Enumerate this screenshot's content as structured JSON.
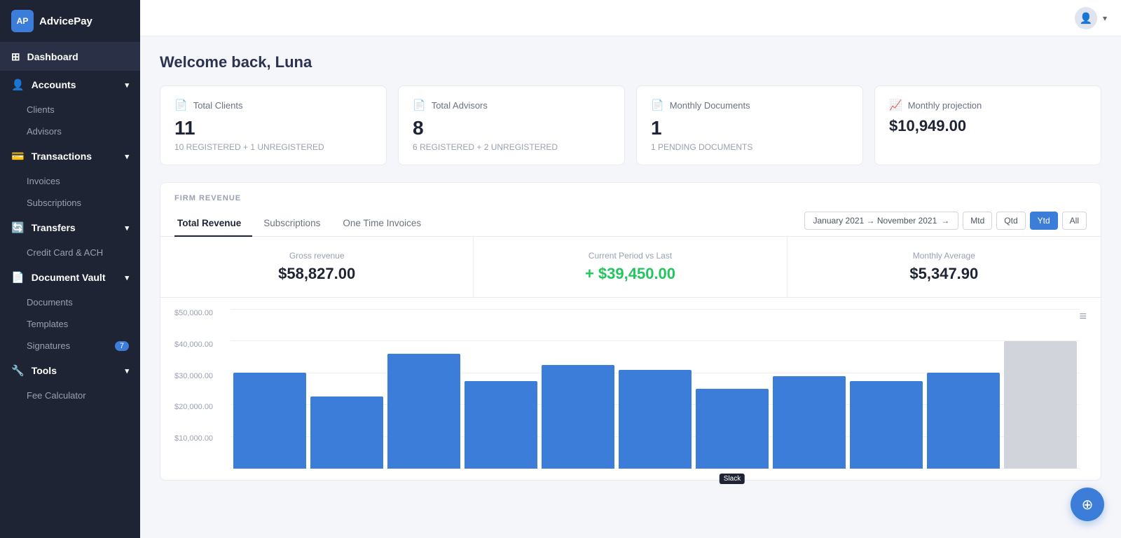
{
  "logo": {
    "abbr": "AP",
    "name": "AdvicePay"
  },
  "topbar": {
    "chevron": "▾"
  },
  "sidebar": {
    "items": [
      {
        "id": "dashboard",
        "label": "Dashboard",
        "icon": "⊞",
        "level": "top",
        "expandable": false
      },
      {
        "id": "accounts",
        "label": "Accounts",
        "icon": "👤",
        "level": "top",
        "expandable": true
      },
      {
        "id": "clients",
        "label": "Clients",
        "level": "sub"
      },
      {
        "id": "advisors",
        "label": "Advisors",
        "level": "sub"
      },
      {
        "id": "transactions",
        "label": "Transactions",
        "icon": "💳",
        "level": "top",
        "expandable": true
      },
      {
        "id": "invoices",
        "label": "Invoices",
        "level": "sub"
      },
      {
        "id": "subscriptions",
        "label": "Subscriptions",
        "level": "sub"
      },
      {
        "id": "transfers",
        "label": "Transfers",
        "icon": "🔄",
        "level": "top",
        "expandable": true
      },
      {
        "id": "credit-card-ach",
        "label": "Credit Card & ACH",
        "level": "sub"
      },
      {
        "id": "document-vault",
        "label": "Document Vault",
        "icon": "📄",
        "level": "top",
        "expandable": true
      },
      {
        "id": "documents",
        "label": "Documents",
        "level": "sub"
      },
      {
        "id": "templates",
        "label": "Templates",
        "level": "sub"
      },
      {
        "id": "signatures",
        "label": "Signatures",
        "level": "sub",
        "badge": "7"
      },
      {
        "id": "tools",
        "label": "Tools",
        "icon": "🔧",
        "level": "top",
        "expandable": true
      },
      {
        "id": "fee-calculator",
        "label": "Fee Calculator",
        "level": "sub"
      }
    ]
  },
  "page": {
    "title": "Welcome back, Luna"
  },
  "stat_cards": [
    {
      "id": "total-clients",
      "icon": "📄",
      "label": "Total Clients",
      "value": "11",
      "sub": "10 REGISTERED + 1 UNREGISTERED"
    },
    {
      "id": "total-advisors",
      "icon": "📄",
      "label": "Total Advisors",
      "value": "8",
      "sub": "6 REGISTERED + 2 UNREGISTERED"
    },
    {
      "id": "monthly-documents",
      "icon": "📄",
      "label": "Monthly Documents",
      "value": "1",
      "sub": "1 PENDING DOCUMENTS"
    },
    {
      "id": "monthly-projection",
      "icon": "📈",
      "label": "Monthly projection",
      "value": "$10,949.00",
      "sub": ""
    }
  ],
  "firm_revenue": {
    "section_label": "FIRM REVENUE",
    "tabs": [
      {
        "id": "total-revenue",
        "label": "Total Revenue",
        "active": true
      },
      {
        "id": "subscriptions",
        "label": "Subscriptions",
        "active": false
      },
      {
        "id": "one-time-invoices",
        "label": "One Time Invoices",
        "active": false
      }
    ],
    "date_range": "January 2021 → November 2021",
    "period_buttons": [
      {
        "id": "mtd",
        "label": "Mtd",
        "active": false
      },
      {
        "id": "qtd",
        "label": "Qtd",
        "active": false
      },
      {
        "id": "ytd",
        "label": "Ytd",
        "active": true
      },
      {
        "id": "all",
        "label": "All",
        "active": false
      }
    ],
    "metrics": [
      {
        "id": "gross-revenue",
        "label": "Gross revenue",
        "value": "$58,827.00",
        "positive": false
      },
      {
        "id": "current-period",
        "label": "Current Period vs Last",
        "value": "+ $39,450.00",
        "positive": true
      },
      {
        "id": "monthly-average",
        "label": "Monthly Average",
        "value": "$5,347.90",
        "positive": false
      }
    ],
    "chart": {
      "y_labels": [
        "$50,000.00",
        "$40,000.00",
        "$30,000.00",
        "$20,000.00",
        "$10,000.00",
        ""
      ],
      "bars": [
        {
          "height_pct": 60,
          "highlighted": false
        },
        {
          "height_pct": 45,
          "highlighted": false
        },
        {
          "height_pct": 72,
          "highlighted": false
        },
        {
          "height_pct": 55,
          "highlighted": false
        },
        {
          "height_pct": 65,
          "highlighted": false
        },
        {
          "height_pct": 62,
          "highlighted": false
        },
        {
          "height_pct": 50,
          "highlighted": false,
          "tooltip": "Slack"
        },
        {
          "height_pct": 58,
          "highlighted": false
        },
        {
          "height_pct": 55,
          "highlighted": false
        },
        {
          "height_pct": 60,
          "highlighted": false
        },
        {
          "height_pct": 80,
          "highlighted": true
        }
      ]
    }
  },
  "fab": {
    "icon": "⊕",
    "label": "help"
  },
  "menu_icon": "≡"
}
